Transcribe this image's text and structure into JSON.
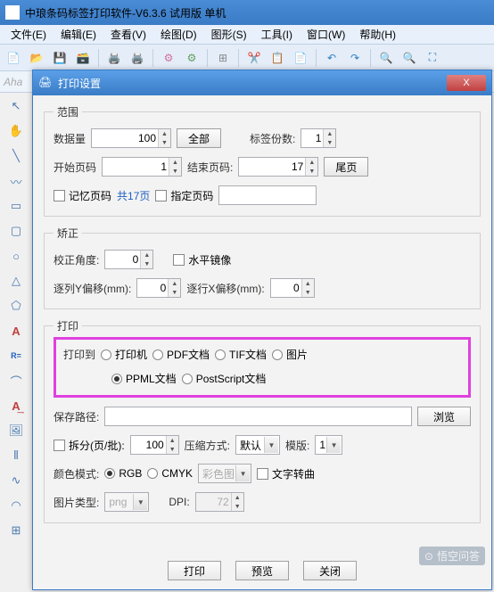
{
  "app_title": "中琅条码标签打印软件-V6.3.6 试用版 单机",
  "menu": [
    "文件(E)",
    "编辑(E)",
    "查看(V)",
    "绘图(D)",
    "图形(S)",
    "工具(I)",
    "窗口(W)",
    "帮助(H)"
  ],
  "search_placeholder": "Aha",
  "dialog": {
    "title": "打印设置",
    "range": {
      "legend": "范围",
      "data_count_label": "数据量",
      "data_count": "100",
      "all_btn": "全部",
      "copies_label": "标签份数:",
      "copies": "1",
      "start_page_label": "开始页码",
      "start_page": "1",
      "end_page_label": "结束页码:",
      "end_page": "17",
      "last_btn": "尾页",
      "remember_label": "记忆页码",
      "total_pages": "共17页",
      "specify_label": "指定页码"
    },
    "correction": {
      "legend": "矫正",
      "angle_label": "校正角度:",
      "angle": "0",
      "mirror_label": "水平镜像",
      "col_offset_label": "逐列Y偏移(mm):",
      "col_offset": "0",
      "row_offset_label": "逐行X偏移(mm):",
      "row_offset": "0"
    },
    "print": {
      "legend": "打印",
      "print_to_label": "打印到",
      "options": [
        "打印机",
        "PDF文档",
        "TIF文档",
        "图片",
        "PPML文档",
        "PostScript文档"
      ],
      "selected": "PPML文档",
      "save_path_label": "保存路径:",
      "browse_btn": "浏览",
      "split_label": "拆分(页/批):",
      "split_value": "100",
      "compress_label": "压缩方式:",
      "compress_value": "默认",
      "template_label": "模版:",
      "template_value": "1",
      "color_label": "颜色模式:",
      "color_options": [
        "RGB",
        "CMYK"
      ],
      "color_selected": "RGB",
      "color_profile": "彩色图",
      "outline_text_label": "文字转曲",
      "image_type_label": "图片类型:",
      "image_type_value": "png",
      "dpi_label": "DPI:",
      "dpi_value": "72"
    },
    "buttons": {
      "print": "打印",
      "preview": "预览",
      "close": "关闭"
    }
  },
  "watermark": "悟空问答"
}
